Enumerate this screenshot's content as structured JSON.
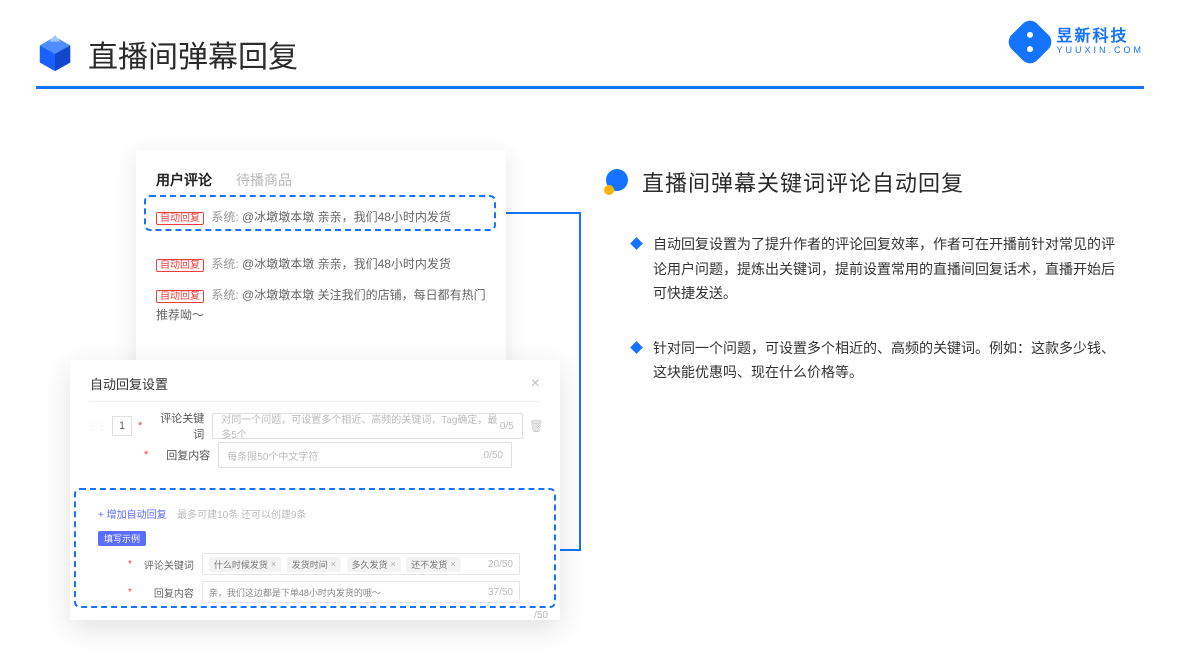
{
  "header": {
    "title": "直播间弹幕回复"
  },
  "brand": {
    "name": "昱新科技",
    "url": "YUUXIN.COM"
  },
  "comments_panel": {
    "tabs": {
      "active": "用户评论",
      "inactive": "待播商品"
    },
    "rows": [
      {
        "tag": "自动回复",
        "sys": "系统:",
        "user": "@冰墩墩本墩",
        "msg": "亲亲，我们48小时内发货"
      },
      {
        "tag": "自动回复",
        "sys": "系统:",
        "user": "@冰墩墩本墩",
        "msg": "亲亲，我们48小时内发货"
      },
      {
        "tag": "自动回复",
        "sys": "系统:",
        "user": "@冰墩墩本墩",
        "msg": "关注我们的店铺，每日都有热门推荐呦～"
      }
    ]
  },
  "dialog": {
    "title": "自动回复设置",
    "num": "1",
    "field1": {
      "label": "评论关键词",
      "placeholder": "对同一个问题，可设置多个相近、高频的关键词，Tag确定，最多5个",
      "count": "0/5"
    },
    "field2": {
      "label": "回复内容",
      "placeholder": "每条限50个中文字符",
      "count": "0/50"
    },
    "add_link": "+ 增加自动回复",
    "add_sub": "最多可建10条 还可以创建9条",
    "example_tag": "填写示例",
    "ex1": {
      "label": "评论关键词",
      "tags": [
        "什么时候发货",
        "发货时间",
        "多久发货",
        "还不发货"
      ],
      "count": "20/50"
    },
    "ex2": {
      "label": "回复内容",
      "value": "亲，我们这边都是下单48小时内发货的哦～",
      "count": "37/50"
    },
    "outer_count": "/50"
  },
  "right": {
    "section_title": "直播间弹幕关键词评论自动回复",
    "bullets": [
      "自动回复设置为了提升作者的评论回复效率，作者可在开播前针对常见的评论用户问题，提炼出关键词，提前设置常用的直播间回复话术，直播开始后可快捷发送。",
      "针对同一个问题，可设置多个相近的、高频的关键词。例如：这款多少钱、这块能优惠吗、现在什么价格等。"
    ]
  }
}
